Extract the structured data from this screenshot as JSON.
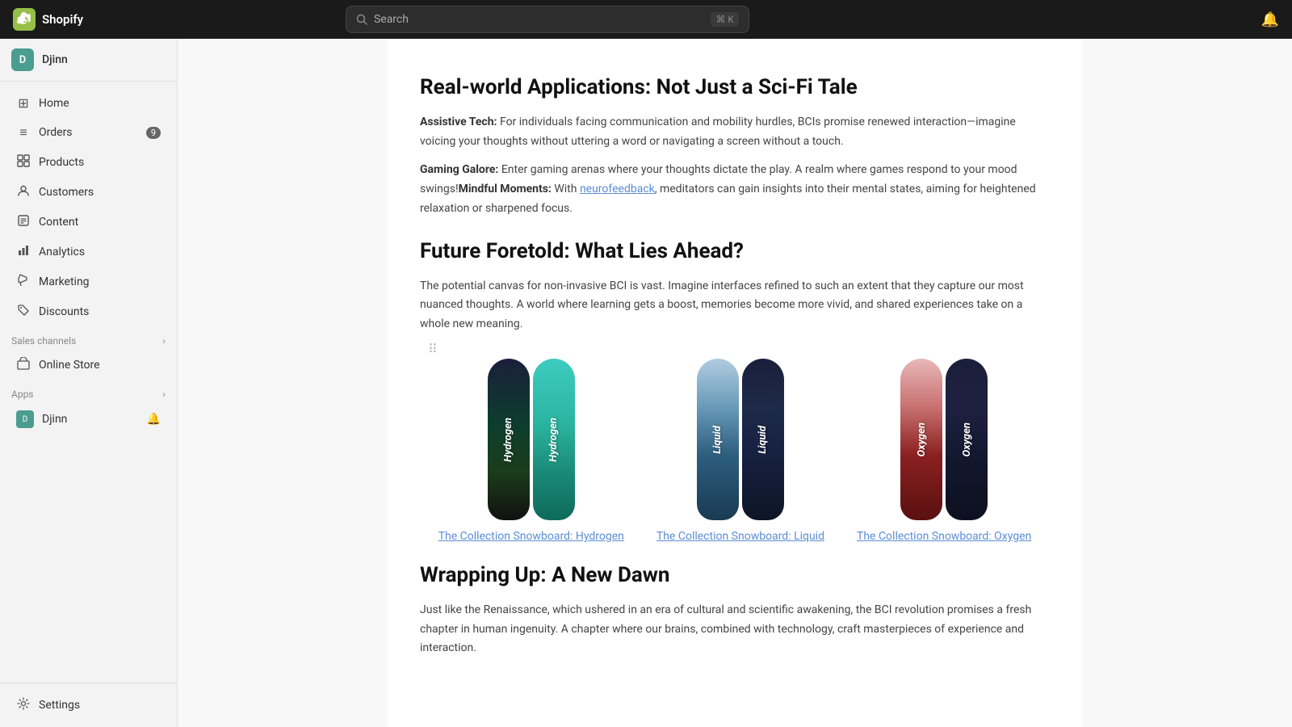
{
  "topbar": {
    "logo_text": "Shopify",
    "search_placeholder": "Search",
    "search_shortcut": "⌘ K"
  },
  "sidebar": {
    "store_name": "Djinn",
    "store_initial": "D",
    "nav_items": [
      {
        "id": "home",
        "label": "Home",
        "icon": "⊞",
        "badge": null
      },
      {
        "id": "orders",
        "label": "Orders",
        "icon": "≡",
        "badge": "9"
      },
      {
        "id": "products",
        "label": "Products",
        "icon": "◻",
        "badge": null
      },
      {
        "id": "customers",
        "label": "Customers",
        "icon": "👤",
        "badge": null
      },
      {
        "id": "content",
        "label": "Content",
        "icon": "📄",
        "badge": null
      },
      {
        "id": "analytics",
        "label": "Analytics",
        "icon": "📊",
        "badge": null
      },
      {
        "id": "marketing",
        "label": "Marketing",
        "icon": "📢",
        "badge": null
      },
      {
        "id": "discounts",
        "label": "Discounts",
        "icon": "🏷",
        "badge": null
      }
    ],
    "sales_channels_label": "Sales channels",
    "sales_channels_items": [
      {
        "id": "online-store",
        "label": "Online Store",
        "icon": "🏪"
      }
    ],
    "apps_label": "Apps",
    "apps_items": [
      {
        "id": "djinn-app",
        "label": "Djinn",
        "initial": "D"
      }
    ],
    "settings_label": "Settings"
  },
  "article": {
    "section1_heading": "Real-world Applications: Not Just a Sci-Fi Tale",
    "section1_p1_prefix": "Assistive Tech:",
    "section1_p1_body": " For individuals facing communication and mobility hurdles, BCIs promise renewed interaction—imagine voicing your thoughts without uttering a word or navigating a screen without a touch.",
    "section1_p2_prefix": "Gaming Galore:",
    "section1_p2_body": " Enter gaming arenas where your thoughts dictate the play. A realm where games respond to your mood swings!",
    "section1_p2_mindful_prefix": "Mindful Moments:",
    "section1_p2_mindful_body": " With neurofeedback, meditators can gain insights into their mental states, aiming for heightened relaxation or sharpened focus.",
    "neurofeedback_link": "neurofeedback",
    "section2_heading": "Future Foretold: What Lies Ahead?",
    "section2_p1": "The potential canvas for non-invasive BCI is vast. Imagine interfaces refined to such an extent that they capture our most nuanced thoughts. A world where learning gets a boost, memories become more vivid, and shared experiences take on a whole new meaning.",
    "products": [
      {
        "id": "hydrogen",
        "link_text": "The Collection Snowboard: Hydrogen",
        "board1_label": "Hydrogen",
        "board2_label": "Hydrogen"
      },
      {
        "id": "liquid",
        "link_text": "The Collection Snowboard: Liquid",
        "board1_label": "Liquid",
        "board2_label": "Liquid"
      },
      {
        "id": "oxygen",
        "link_text": "The Collection Snowboard: Oxygen",
        "board1_label": "Oxygen",
        "board2_label": "Oxygen"
      }
    ],
    "section3_heading": "Wrapping Up: A New Dawn",
    "section3_p1": "Just like the Renaissance, which ushered in an era of cultural and scientific awakening, the BCI revolution promises a fresh chapter in human ingenuity. A chapter where our brains, combined with technology, craft masterpieces of experience and interaction."
  }
}
